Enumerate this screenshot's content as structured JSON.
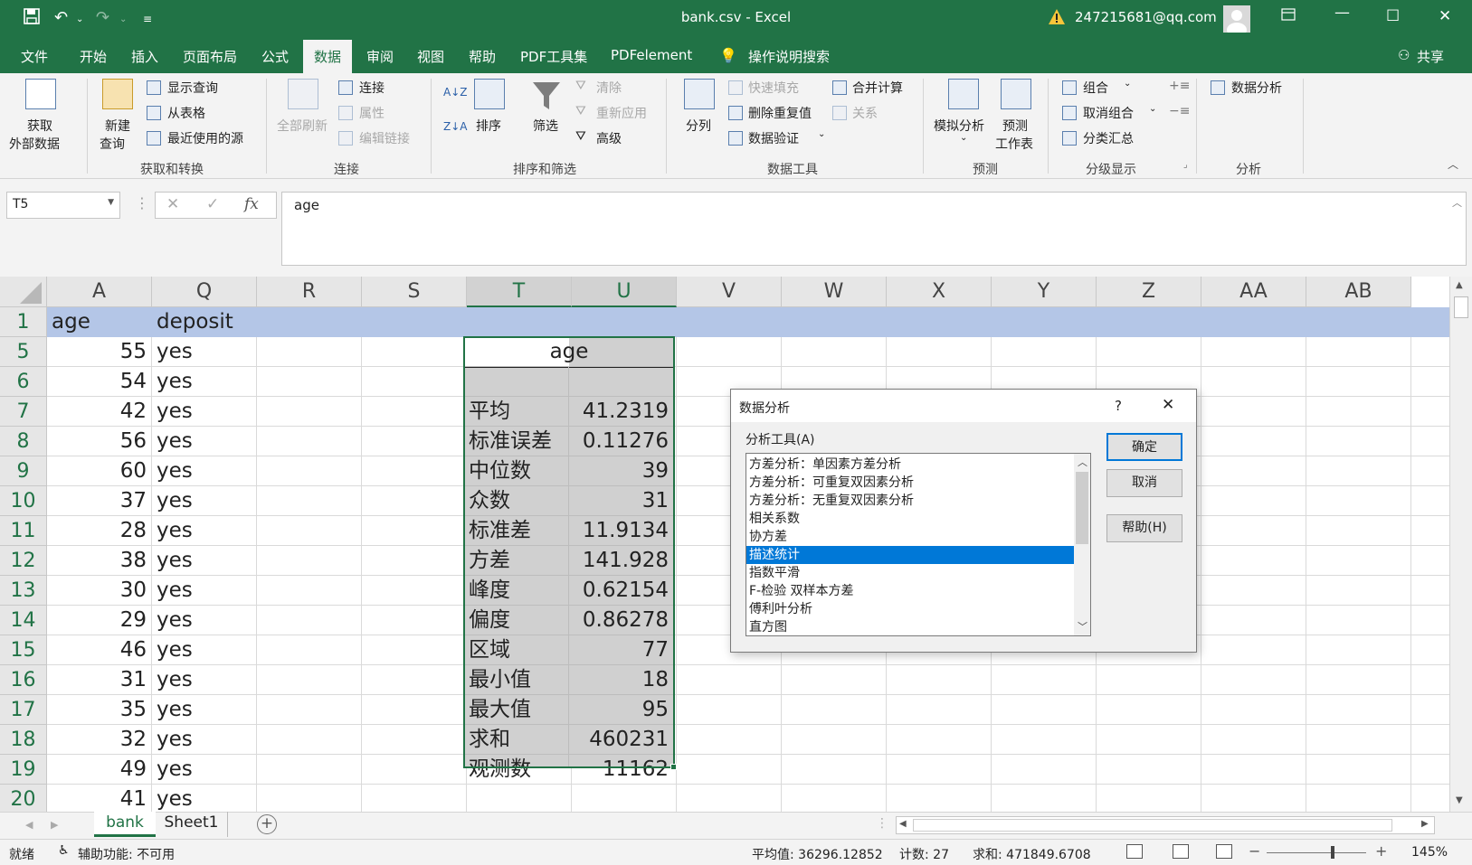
{
  "window": {
    "title": "bank.csv  -  Excel",
    "account": "247215681@qq.com"
  },
  "ribbon_tabs": [
    "文件",
    "开始",
    "插入",
    "页面布局",
    "公式",
    "数据",
    "审阅",
    "视图",
    "帮助",
    "PDF工具集",
    "PDFelement",
    "操作说明搜索"
  ],
  "share_label": "共享",
  "ribbon": {
    "get_external_line1": "获取",
    "get_external_line2": "外部数据",
    "new_query_line1": "新建",
    "new_query_line2": "查询",
    "show_queries": "显示查询",
    "from_table": "从表格",
    "recent_sources": "最近使用的源",
    "group_get_transform": "获取和转换",
    "refresh_all": "全部刷新",
    "connections": "连接",
    "properties": "属性",
    "edit_links": "编辑链接",
    "group_connections": "连接",
    "sort": "排序",
    "filter": "筛选",
    "clear": "清除",
    "reapply": "重新应用",
    "advanced": "高级",
    "group_sort_filter": "排序和筛选",
    "text_to_columns": "分列",
    "flash_fill": "快速填充",
    "remove_duplicates": "删除重复值",
    "data_validation": "数据验证",
    "consolidate": "合并计算",
    "relationships": "关系",
    "group_data_tools": "数据工具",
    "what_if": "模拟分析",
    "forecast_line1": "预测",
    "forecast_line2": "工作表",
    "group_forecast": "预测",
    "group_btn": "组合",
    "ungroup_btn": "取消组合",
    "subtotal": "分类汇总",
    "group_outline": "分级显示",
    "data_analysis": "数据分析",
    "group_analysis": "分析"
  },
  "formula_bar": {
    "name_box": "T5",
    "formula": "age"
  },
  "columns": [
    "A",
    "Q",
    "R",
    "S",
    "T",
    "U",
    "V",
    "W",
    "X",
    "Y",
    "Z",
    "AA",
    "AB"
  ],
  "header_row": {
    "row": "1",
    "a": "age",
    "q": "deposit"
  },
  "rows": [
    {
      "row": "5",
      "a": "55",
      "q": "yes"
    },
    {
      "row": "6",
      "a": "54",
      "q": "yes"
    },
    {
      "row": "7",
      "a": "42",
      "q": "yes"
    },
    {
      "row": "8",
      "a": "56",
      "q": "yes"
    },
    {
      "row": "9",
      "a": "60",
      "q": "yes"
    },
    {
      "row": "10",
      "a": "37",
      "q": "yes"
    },
    {
      "row": "11",
      "a": "28",
      "q": "yes"
    },
    {
      "row": "12",
      "a": "38",
      "q": "yes"
    },
    {
      "row": "13",
      "a": "30",
      "q": "yes"
    },
    {
      "row": "14",
      "a": "29",
      "q": "yes"
    },
    {
      "row": "15",
      "a": "46",
      "q": "yes"
    },
    {
      "row": "16",
      "a": "31",
      "q": "yes"
    },
    {
      "row": "17",
      "a": "35",
      "q": "yes"
    },
    {
      "row": "18",
      "a": "32",
      "q": "yes"
    },
    {
      "row": "19",
      "a": "49",
      "q": "yes"
    },
    {
      "row": "20",
      "a": "41",
      "q": "yes"
    }
  ],
  "stats": {
    "header": "age",
    "items": [
      {
        "label": "平均",
        "value": "41.2319"
      },
      {
        "label": "标准误差",
        "value": "0.11276"
      },
      {
        "label": "中位数",
        "value": "39"
      },
      {
        "label": "众数",
        "value": "31"
      },
      {
        "label": "标准差",
        "value": "11.9134"
      },
      {
        "label": "方差",
        "value": "141.928"
      },
      {
        "label": "峰度",
        "value": "0.62154"
      },
      {
        "label": "偏度",
        "value": "0.86278"
      },
      {
        "label": "区域",
        "value": "77"
      },
      {
        "label": "最小值",
        "value": "18"
      },
      {
        "label": "最大值",
        "value": "95"
      },
      {
        "label": "求和",
        "value": "460231"
      },
      {
        "label": "观测数",
        "value": "11162"
      }
    ]
  },
  "dialog": {
    "title": "数据分析",
    "help_char": "?",
    "list_label": "分析工具(A)",
    "tools": [
      "方差分析：单因素方差分析",
      "方差分析：可重复双因素分析",
      "方差分析：无重复双因素分析",
      "相关系数",
      "协方差",
      "描述统计",
      "指数平滑",
      "F-检验 双样本方差",
      "傅利叶分析",
      "直方图"
    ],
    "selected_index": 5,
    "ok": "确定",
    "cancel": "取消",
    "help": "帮助(H)"
  },
  "sheets": [
    "bank",
    "Sheet1"
  ],
  "status": {
    "ready": "就绪",
    "accessibility": "辅助功能: 不可用",
    "average": "平均值: 36296.12852",
    "count": "计数: 27",
    "sum": "求和: 471849.6708",
    "zoom": "145%"
  }
}
